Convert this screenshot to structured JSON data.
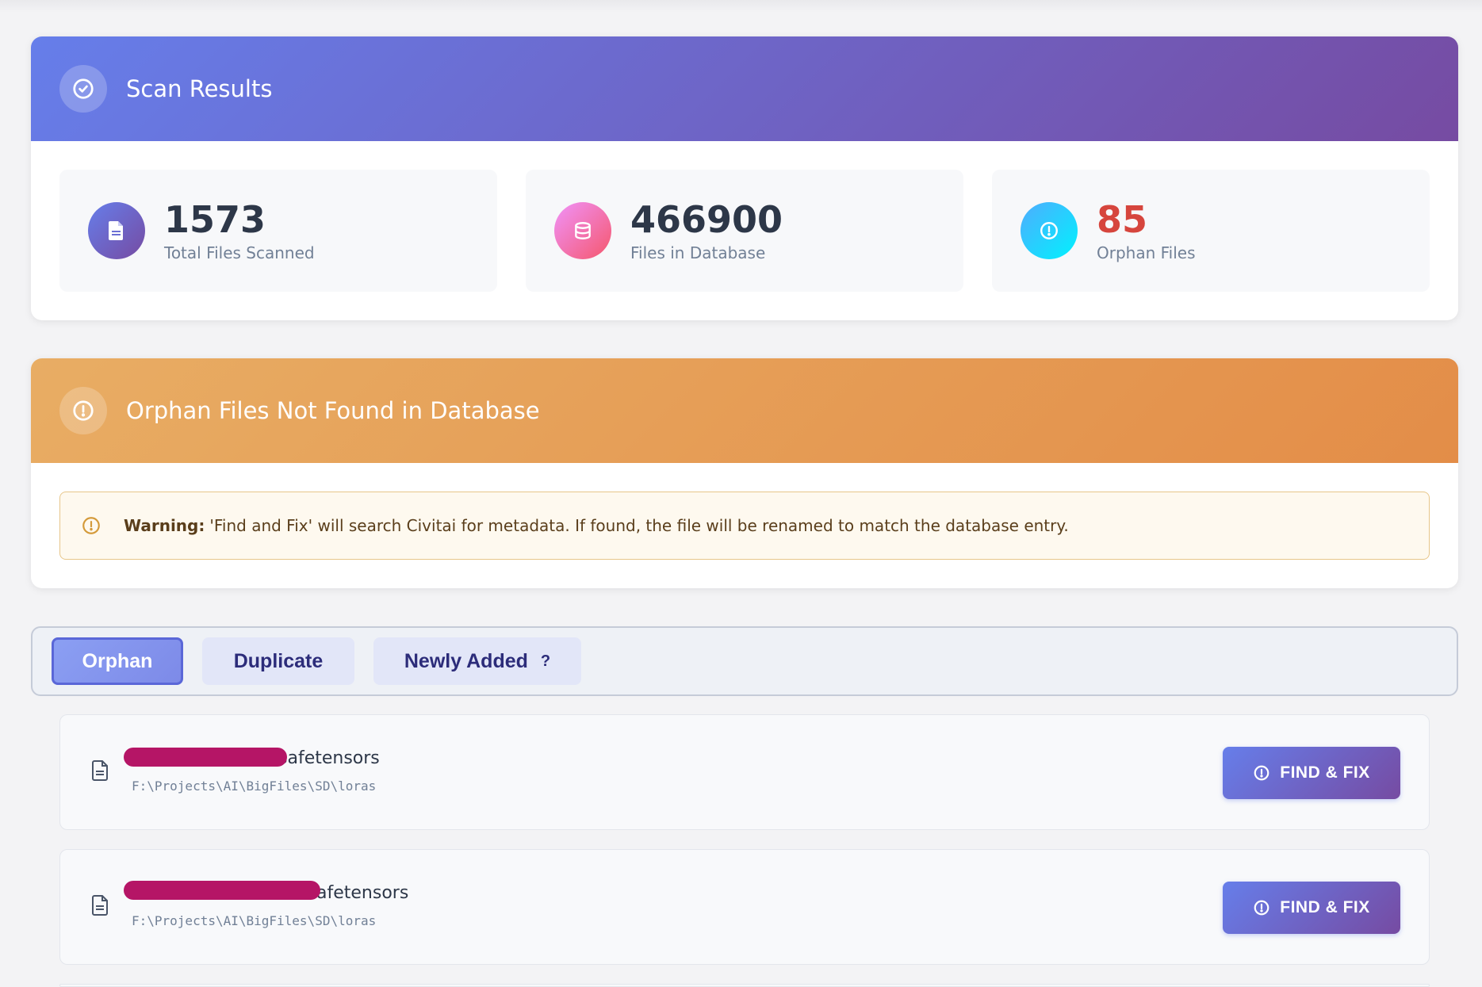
{
  "scan_results": {
    "title": "Scan Results",
    "stats": [
      {
        "value": "1573",
        "label": "Total Files Scanned",
        "icon": "file-icon"
      },
      {
        "value": "466900",
        "label": "Files in Database",
        "icon": "database-icon"
      },
      {
        "value": "85",
        "label": "Orphan Files",
        "icon": "alert-circle-icon"
      }
    ]
  },
  "orphan_section": {
    "title": "Orphan Files Not Found in Database",
    "warning_strong": "Warning:",
    "warning_text": "'Find and Fix' will search Civitai for metadata. If found, the file will be renamed to match the database entry."
  },
  "tabs": [
    {
      "label": "Orphan",
      "active": true
    },
    {
      "label": "Duplicate",
      "active": false
    },
    {
      "label": "Newly Added",
      "active": false,
      "help": "?"
    }
  ],
  "files": [
    {
      "name_visible": "safetensors",
      "path": "F:\\Projects\\AI\\BigFiles\\SD\\loras",
      "action": "FIND & FIX"
    },
    {
      "name_visible": "afetensors",
      "path": "F:\\Projects\\AI\\BigFiles\\SD\\loras",
      "action": "FIND & FIX"
    }
  ],
  "colors": {
    "header_purple_start": "#667eea",
    "header_purple_end": "#764ba2",
    "header_orange_start": "#e8ad64",
    "header_orange_end": "#e38d48",
    "orphan_count": "#d6453d",
    "redaction": "#b51566"
  }
}
